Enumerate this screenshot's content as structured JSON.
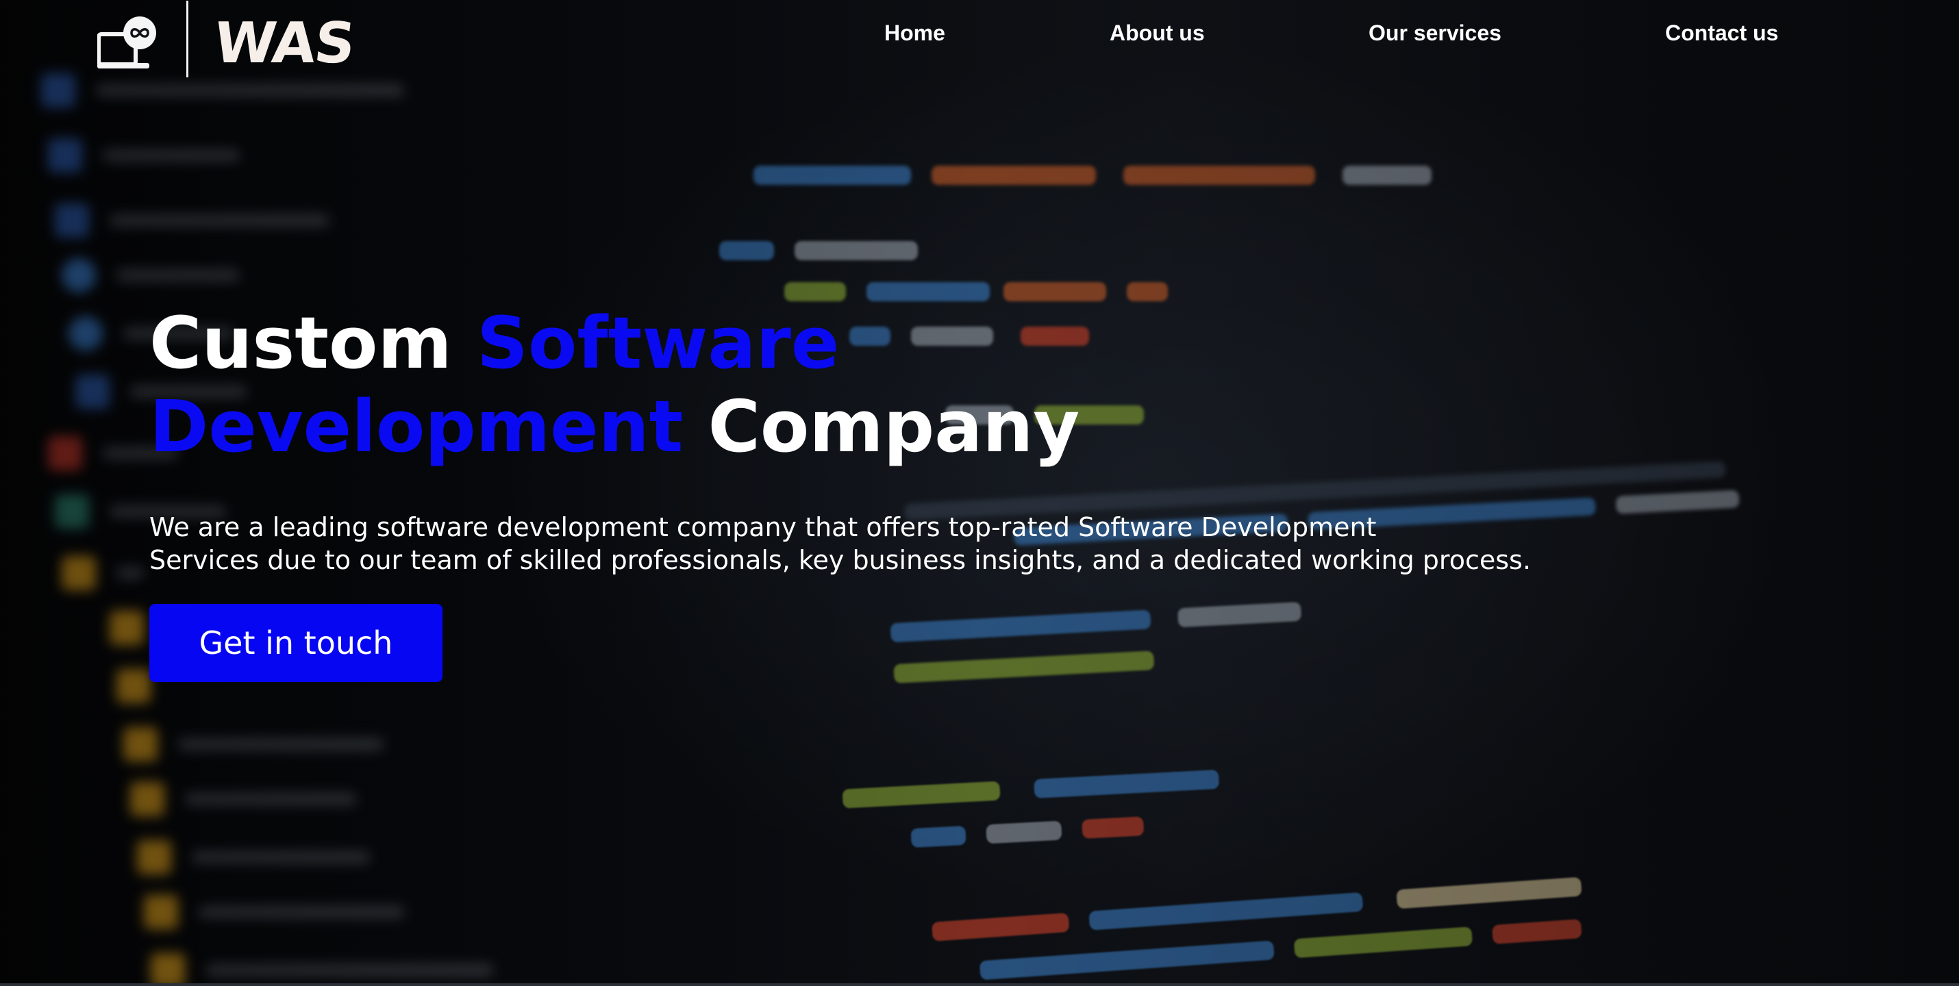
{
  "brand": {
    "logo_icon": "laptop-infinity-icon",
    "name": "WAS"
  },
  "nav": {
    "items": [
      {
        "label": "Home"
      },
      {
        "label": "About us"
      },
      {
        "label": "Our services"
      },
      {
        "label": "Contact us"
      }
    ]
  },
  "hero": {
    "title": {
      "part1": "Custom ",
      "accent1": "Software",
      "accent2": "Development",
      "part2": " Company"
    },
    "description": {
      "line1": "We are a leading software development company that offers top-rated Software Development",
      "line2": "Services due to our team of skilled professionals, key business insights, and a dedicated working process."
    },
    "cta_label": "Get in touch"
  },
  "colors": {
    "accent": "#0a0af2",
    "button": "#0606f2",
    "text": "#ffffff",
    "background": "#0b0e13"
  }
}
